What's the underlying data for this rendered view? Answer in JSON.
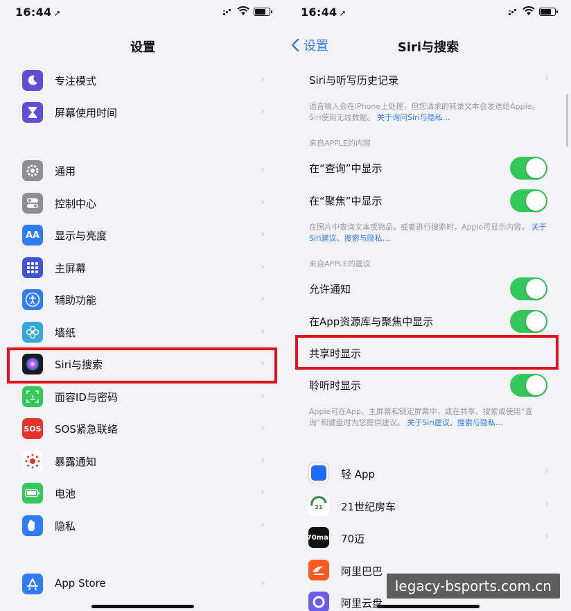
{
  "status": {
    "time": "16:44",
    "location_arrow": "➚"
  },
  "left": {
    "title": "设置",
    "items": [
      {
        "label": "专注模式",
        "icon": "moon-icon",
        "color": "#5b4fd6"
      },
      {
        "label": "屏幕使用时间",
        "icon": "hourglass-icon",
        "color": "#5b4fd6"
      },
      {
        "label": "通用",
        "icon": "gear-icon",
        "color": "#8e8e93"
      },
      {
        "label": "控制中心",
        "icon": "switches-icon",
        "color": "#8e8e93"
      },
      {
        "label": "显示与亮度",
        "icon": "text-size-icon",
        "color": "#2f7cf6",
        "glyph": "AA"
      },
      {
        "label": "主屏幕",
        "icon": "grid-icon",
        "color": "#3f52d9"
      },
      {
        "label": "辅助功能",
        "icon": "accessibility-icon",
        "color": "#2f7cf6"
      },
      {
        "label": "墙纸",
        "icon": "flower-icon",
        "color": "#35a6d9"
      },
      {
        "label": "Siri与搜索",
        "icon": "siri-icon",
        "color": "#222"
      },
      {
        "label": "面容ID与密码",
        "icon": "face-id-icon",
        "color": "#34c759"
      },
      {
        "label": "SOS紧急联络",
        "icon": "sos-icon",
        "color": "#e5322d",
        "glyph": "SOS"
      },
      {
        "label": "暴露通知",
        "icon": "exposure-icon",
        "color": "#ffffff"
      },
      {
        "label": "电池",
        "icon": "battery-icon",
        "color": "#34c759"
      },
      {
        "label": "隐私",
        "icon": "hand-icon",
        "color": "#2f7cf6"
      },
      {
        "label": "App Store",
        "icon": "app-store-icon",
        "color": "#2f7cf6"
      }
    ]
  },
  "right": {
    "back_label": "设置",
    "title": "Siri与搜索",
    "history_label": "Siri与听写历史记录",
    "note1": "语音输入会在iPhone上处理，但您请求的转录文本会发送给Apple。Siri使用无线数据。",
    "note1_link": "关于询问Siri与隐私…",
    "section1": "来自APPLE的内容",
    "content_rows": [
      "在“查询”中显示",
      "在“聚焦”中显示"
    ],
    "note2": "在照片中查询文本或物品，或者进行搜索时，Apple可显示内容。",
    "note2_link": "关于Siri建议、搜索与隐私…",
    "section2": "来自APPLE的建议",
    "suggest_rows": [
      "允许通知",
      "在App资源库与聚焦中显示",
      "共享时显示",
      "聆听时显示"
    ],
    "note3": "Apple可在App、主屏幕和锁定屏幕中，或在共享、搜索或使用“查询”和键盘时为您提供建议。",
    "note3_link": "关于Siri建议、搜索与隐私…",
    "apps": [
      {
        "label": "轻 App",
        "icon": "light-app-icon",
        "color": "#1f6bff"
      },
      {
        "label": "21世纪房车",
        "icon": "rv-icon",
        "color": "#ffffff"
      },
      {
        "label": "70迈",
        "icon": "70mai-icon",
        "color": "#111111",
        "glyph": "70mai"
      },
      {
        "label": "阿里巴巴",
        "icon": "alibaba-icon",
        "color": "#ff5a1f"
      },
      {
        "label": "阿里云盘",
        "icon": "cloud-drive-icon",
        "color": "#6c5ce7"
      }
    ]
  },
  "watermark": "legacy-bsports.com.cn"
}
